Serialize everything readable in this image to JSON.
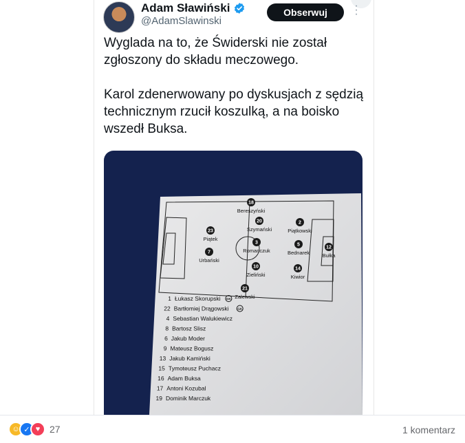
{
  "tweet": {
    "display_name": "Adam Sławiński",
    "handle": "@AdamSlawinski",
    "follow_label": "Obserwuj",
    "paragraphs": [
      "Wyglada na to, że Świderski nie został zgłoszony do składu meczowego.",
      "Karol zdenerwowany po dyskusjach z sędzią technicznym rzucił koszulką, a na boisko wszedł Buksa."
    ],
    "icons": {
      "verified": "verified-badge-icon",
      "more": "more-options-icon",
      "avatar": "avatar"
    }
  },
  "lineup_sheet": {
    "players_on_pitch": [
      {
        "number": "18",
        "name": "Bereszyński"
      },
      {
        "number": "20",
        "name": "Szymański"
      },
      {
        "number": "2",
        "name": "Piątkowski"
      },
      {
        "number": "23",
        "name": "Piątek"
      },
      {
        "number": "3",
        "name": "Romanczuk"
      },
      {
        "number": "5",
        "name": "Bednarek"
      },
      {
        "number": "12",
        "name": "Bułka"
      },
      {
        "number": "7",
        "name": "Urbański"
      },
      {
        "number": "10",
        "name": "Zieliński"
      },
      {
        "number": "14",
        "name": "Kiwior"
      },
      {
        "number": "21",
        "name": "Zalewski"
      }
    ],
    "bench": [
      {
        "number": "1",
        "name": "Łukasz Skorupski",
        "tag": "GK"
      },
      {
        "number": "22",
        "name": "Bartłomiej Drągowski",
        "tag": "GK"
      },
      {
        "number": "4",
        "name": "Sebastian Walukiewicz"
      },
      {
        "number": "8",
        "name": "Bartosz Slisz"
      },
      {
        "number": "6",
        "name": "Jakub Moder"
      },
      {
        "number": "9",
        "name": "Mateusz Bogusz"
      },
      {
        "number": "13",
        "name": "Jakub Kamiński"
      },
      {
        "number": "15",
        "name": "Tymoteusz Puchacz"
      },
      {
        "number": "16",
        "name": "Adam Buksa"
      },
      {
        "number": "17",
        "name": "Antoni Kozubal"
      },
      {
        "number": "19",
        "name": "Dominik Marczuk"
      }
    ]
  },
  "footer": {
    "reaction_count": "27",
    "comments_label": "1 komentarz",
    "reaction_icons": [
      "haha-reaction-icon",
      "like-reaction-icon",
      "love-reaction-icon"
    ]
  },
  "colors": {
    "text": "#0f1419",
    "secondary": "#536471",
    "button": "#0f1419",
    "verified": "#1d9bf0",
    "photo_background": "#14224e"
  }
}
